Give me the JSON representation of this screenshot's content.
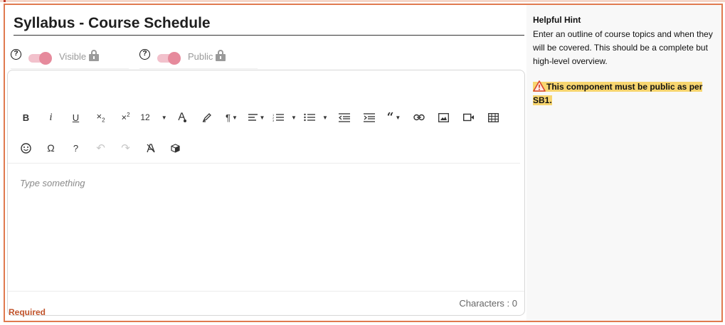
{
  "section": {
    "title": "Syllabus - Course Schedule",
    "toggles": [
      {
        "label": "Visible",
        "on": true
      },
      {
        "label": "Public",
        "on": true
      }
    ]
  },
  "toolbar": {
    "row1": [
      {
        "name": "bold-button",
        "glyph": "B"
      },
      {
        "name": "italic-button",
        "glyph": "i"
      },
      {
        "name": "underline-button",
        "glyph": "U"
      },
      {
        "name": "subscript-button",
        "glyph": "×₂"
      },
      {
        "name": "superscript-button",
        "glyph": "×²"
      },
      {
        "name": "font-size-dropdown",
        "glyph": "12"
      },
      {
        "name": "font-color-button",
        "glyph": "A"
      },
      {
        "name": "highlight-button",
        "glyph": "✎"
      },
      {
        "name": "paragraph-format-dropdown",
        "glyph": "¶"
      },
      {
        "name": "align-dropdown",
        "glyph": "≡"
      },
      {
        "name": "ordered-list-dropdown",
        "glyph": "☰"
      },
      {
        "name": "unordered-list-dropdown",
        "glyph": "☰"
      },
      {
        "name": "outdent-button",
        "glyph": "⇤"
      },
      {
        "name": "indent-button",
        "glyph": "⇥"
      },
      {
        "name": "quote-dropdown",
        "glyph": "❝"
      },
      {
        "name": "insert-link-button",
        "glyph": "⊂⊃"
      },
      {
        "name": "insert-image-button",
        "glyph": "▣"
      },
      {
        "name": "insert-video-button",
        "glyph": "▶"
      },
      {
        "name": "insert-table-button",
        "glyph": "▦"
      }
    ],
    "row2": [
      {
        "name": "emoticons-button",
        "glyph": "☺"
      },
      {
        "name": "special-characters-button",
        "glyph": "Ω"
      },
      {
        "name": "help-button",
        "glyph": "?"
      },
      {
        "name": "undo-button",
        "glyph": "↶"
      },
      {
        "name": "redo-button",
        "glyph": "↷"
      },
      {
        "name": "clear-formatting-button",
        "glyph": "Ⱥ"
      },
      {
        "name": "embed-button",
        "glyph": "⬢"
      }
    ]
  },
  "editor": {
    "placeholder": "Type something",
    "char_count": "Characters : 0"
  },
  "validation": {
    "required": "Required"
  },
  "hint": {
    "title": "Helpful Hint",
    "text": "Enter an outline of course topics and when they will be covered. This should be a complete but high-level overview.",
    "warning": "This component must be public as per SB1."
  },
  "colors": {
    "frame_border": "#e07a4f",
    "toggle_on": "#e68a9c",
    "warning_highlight": "#f7d56f",
    "required_text": "#c0532b"
  }
}
